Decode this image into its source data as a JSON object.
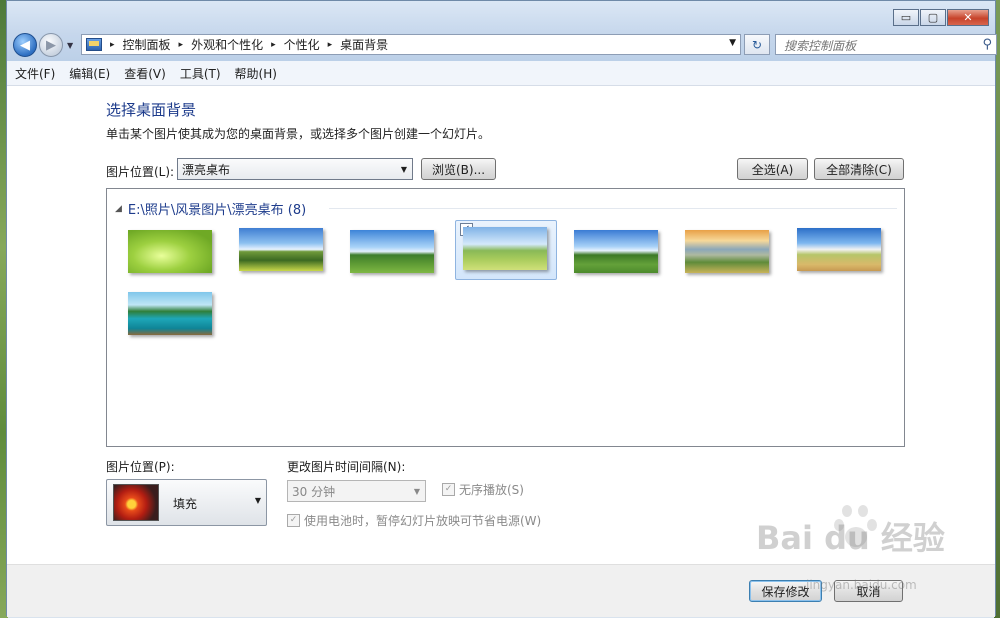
{
  "window": {
    "controls": {
      "minimize": "▭",
      "maximize": "▢",
      "close": "✕"
    }
  },
  "nav": {
    "back_glyph": "◀",
    "forward_glyph": "▶",
    "recent_glyph": "▼",
    "breadcrumbs": [
      "控制面板",
      "外观和个性化",
      "个性化",
      "桌面背景"
    ],
    "separator": "▸",
    "dropdown_glyph": "▼",
    "refresh_glyph": "↻",
    "search_placeholder": "搜索控制面板",
    "search_glyph": "⚲"
  },
  "menubar": [
    "文件(F)",
    "编辑(E)",
    "查看(V)",
    "工具(T)",
    "帮助(H)"
  ],
  "content": {
    "title": "选择桌面背景",
    "subtitle": "单击某个图片使其成为您的桌面背景，或选择多个图片创建一个幻灯片。",
    "location_label": "图片位置(L):",
    "location_value": "漂亮桌布",
    "browse_label": "浏览(B)...",
    "select_all_label": "全选(A)",
    "clear_all_label": "全部清除(C)",
    "gallery": {
      "group_title": "E:\\照片\\风景图片\\漂亮桌布 (8)",
      "thumbnails": [
        {
          "name": "wallpaper-1",
          "selected": false
        },
        {
          "name": "wallpaper-2",
          "selected": false
        },
        {
          "name": "wallpaper-3",
          "selected": false
        },
        {
          "name": "wallpaper-4",
          "selected": true
        },
        {
          "name": "wallpaper-5",
          "selected": false
        },
        {
          "name": "wallpaper-6",
          "selected": false
        },
        {
          "name": "wallpaper-7",
          "selected": false
        },
        {
          "name": "wallpaper-8",
          "selected": false
        }
      ],
      "check_glyph": "✓"
    },
    "position_label": "图片位置(P):",
    "position_value": "填充",
    "interval_label": "更改图片时间间隔(N):",
    "interval_value": "30 分钟",
    "shuffle_label": "无序播放(S)",
    "shuffle_checked": true,
    "battery_label": "使用电池时，暂停幻灯片放映可节省电源(W)",
    "battery_checked": true
  },
  "footer": {
    "save_label": "保存修改",
    "cancel_label": "取消"
  },
  "watermark": {
    "text": "Bai du 经验",
    "sub": "jingyan.baidu.com"
  }
}
